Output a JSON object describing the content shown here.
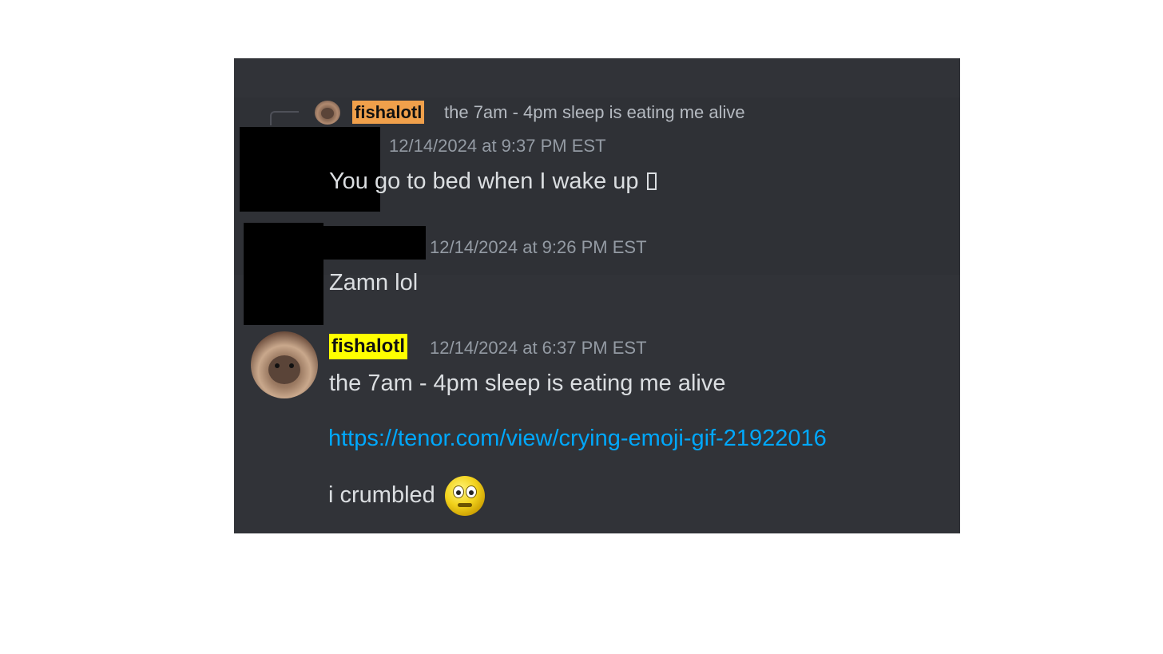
{
  "messages": [
    {
      "reply_to": {
        "username": "fishalotl",
        "text": "the 7am - 4pm sleep is eating me alive"
      },
      "username": "",
      "timestamp": "12/14/2024 at 9:37 PM EST",
      "text": "You go to bed when I wake up"
    },
    {
      "username": "",
      "timestamp": "12/14/2024 at 9:26 PM EST",
      "text": "Zamn lol"
    },
    {
      "username": "fishalotl",
      "timestamp": "12/14/2024 at 6:37 PM EST",
      "lines": [
        "the 7am - 4pm sleep is eating me alive",
        "https://tenor.com/view/crying-emoji-gif-21922016",
        "i crumbled"
      ]
    }
  ],
  "colors": {
    "panel_bg": "#313338",
    "highlight_bg": "#2f3136",
    "link": "#00a8fc",
    "reply_name_highlight": "#f0a04b",
    "username_highlight": "#ffff00",
    "timestamp": "#949ba4",
    "message_text": "#dbdee1"
  },
  "icons": {
    "reply_avatar": "otter-hood-avatar",
    "main_avatar": "otter-hood-avatar",
    "emoji": "flushed-emoji",
    "unknown_glyph": "missing-glyph-box"
  }
}
